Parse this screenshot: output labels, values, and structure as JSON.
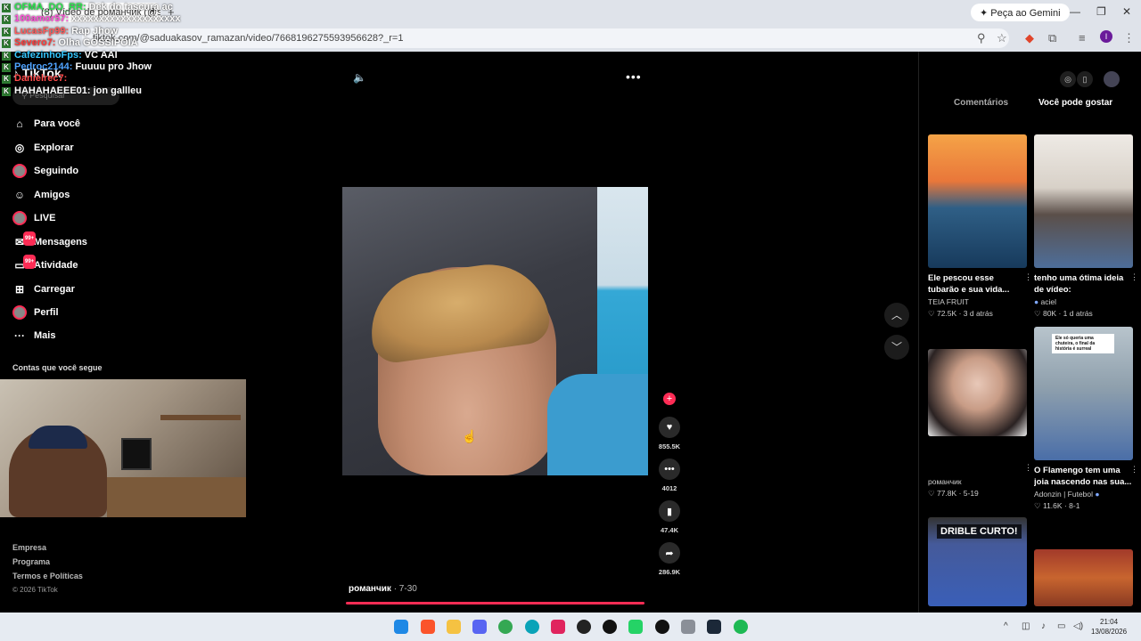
{
  "browser": {
    "tab_title": "(8) Vídeo de романчик (@sa",
    "close": "×",
    "new_tab": "+",
    "gemini_button": "Peça ao Gemini",
    "url": "tiktok.com/@saduakasov_ramazan/video/7668196275593956628?_r=1",
    "profile_initial": "I"
  },
  "chat": [
    {
      "user": "OFMA_DO_RR:",
      "msg": "Dek do tascura ac",
      "color": "#29e24d"
    },
    {
      "user": "100amor57:",
      "msg": "xxxxxxxxxxxxxxxxxxxx",
      "color": "#ff4fd8"
    },
    {
      "user": "LucasFp99:",
      "msg": "Rap Jhow",
      "color": "#ff5b5b"
    },
    {
      "user": "Severo7:",
      "msg": "Olha GOSSIPOIA",
      "color": "#ff3b3b"
    },
    {
      "user": "CafezinhoFps:",
      "msg": "VC AAI",
      "color": "#34c6ff"
    },
    {
      "user": "Pedroc2144:",
      "msg": "Fuuuu pro Jhow",
      "color": "#4fa3ff"
    },
    {
      "user": "Danielrec7:",
      "msg": "",
      "color": "#ff4b4b"
    },
    {
      "user": "HAHAHAEEE01:",
      "msg": "jon gallleu",
      "color": "#ffffff"
    }
  ],
  "sidebar": {
    "logo": "TikTok",
    "search_placeholder": "Pesquisar",
    "items": [
      {
        "label": "Para você",
        "icon": "⌂"
      },
      {
        "label": "Explorar",
        "icon": "◎"
      },
      {
        "label": "Seguindo",
        "icon": ""
      },
      {
        "label": "Amigos",
        "icon": "☺"
      },
      {
        "label": "LIVE",
        "icon": ""
      },
      {
        "label": "Mensagens",
        "icon": "✉",
        "badge": "99+"
      },
      {
        "label": "Atividade",
        "icon": "▭",
        "badge": "99+"
      },
      {
        "label": "Carregar",
        "icon": "⊞"
      },
      {
        "label": "Perfil",
        "icon": ""
      },
      {
        "label": "Mais",
        "icon": "···"
      }
    ],
    "following_heading": "Contas que você segue",
    "footer_links": [
      "Empresa",
      "Programa",
      "Termos e Políticas"
    ],
    "copyright": "© 2026 TikTok"
  },
  "video": {
    "author": "романчик",
    "date": " · 7-30",
    "progress": 1.0,
    "likes": "855.5K",
    "comments": "4012",
    "saves": "47.4K",
    "shares": "286.9K"
  },
  "right_panel": {
    "tab_comments": "Comentários",
    "tab_suggestions": "Você pode gostar",
    "cards": [
      {
        "title": "Ele pescou esse tubarão e sua vida...",
        "author": "TEIA FRUIT",
        "likes": "♡ 72.5K",
        "time": "3 d atrás"
      },
      {
        "title": "tenho uma ótima ideia de vídeo:",
        "author": "aciel",
        "likes": "♡ 80K",
        "time": "1 d atrás"
      },
      {
        "title": "",
        "author": "романчик",
        "likes": "♡ 77.8K",
        "time": "5-19"
      },
      {
        "title": "O Flamengo tem uma joia nascendo nas sua...",
        "author": "Adonzin | Futebol",
        "likes": "♡ 11.6K",
        "time": "8-1",
        "overlay": "Ele só queria uma chuteira, o final da história é surreal"
      },
      {
        "overlay": "DRIBLE CURTO!"
      }
    ]
  },
  "taskbar": {
    "time": "21:04",
    "date": "13/08/2026"
  }
}
